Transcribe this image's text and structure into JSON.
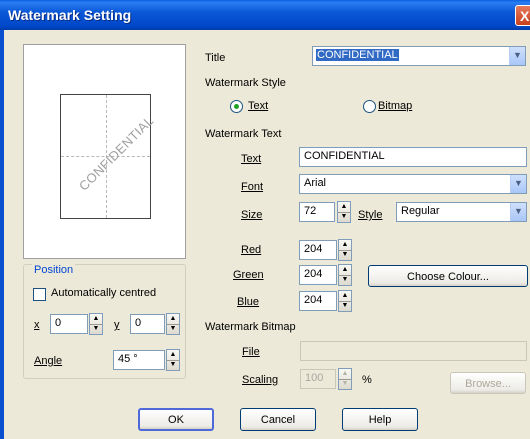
{
  "window": {
    "title": "Watermark Setting",
    "close_glyph": "X"
  },
  "preview": {
    "watermark_text": "CONFIDENTIAL"
  },
  "position": {
    "group_title": "Position",
    "auto_centred_label": "Automatically centred",
    "auto_centred_checked": false,
    "x_label": "x",
    "x_value": "0",
    "y_label": "y",
    "y_value": "0",
    "angle_label": "Angle",
    "angle_value": "45 °"
  },
  "title": {
    "label": "Title",
    "value": "CONFIDENTIAL"
  },
  "style": {
    "heading": "Watermark Style",
    "text_option": "Text",
    "bitmap_option": "Bitmap",
    "selected": "Text"
  },
  "text": {
    "heading": "Watermark Text",
    "text_label": "Text",
    "text_value": "CONFIDENTIAL",
    "font_label": "Font",
    "font_value": "Arial",
    "size_label": "Size",
    "size_value": "72",
    "style_label": "Style",
    "style_value": "Regular",
    "red_label": "Red",
    "red_value": "204",
    "green_label": "Green",
    "green_value": "204",
    "blue_label": "Blue",
    "blue_value": "204",
    "choose_colour_label": "Choose Colour..."
  },
  "bitmap": {
    "heading": "Watermark Bitmap",
    "file_label": "File",
    "file_value": "",
    "scaling_label": "Scaling",
    "scaling_value": "100",
    "scaling_unit": "%",
    "browse_label": "Browse..."
  },
  "footer": {
    "ok_label": "OK",
    "cancel_label": "Cancel",
    "help_label": "Help"
  }
}
